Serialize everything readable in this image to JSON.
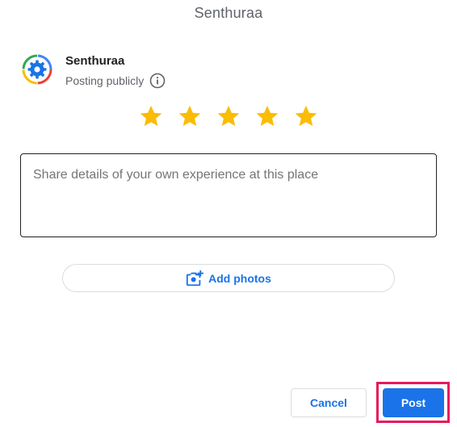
{
  "dialog": {
    "title": "Senthuraa"
  },
  "author": {
    "name": "Senthuraa",
    "visibility": "Posting publicly"
  },
  "rating": {
    "value": 5,
    "max": 5,
    "star_color": "#fbbc04"
  },
  "review": {
    "placeholder": "Share details of your own experience at this place",
    "value": ""
  },
  "add_photos": {
    "label": "Add photos"
  },
  "actions": {
    "cancel_label": "Cancel",
    "post_label": "Post"
  },
  "colors": {
    "accent": "#1a73e8",
    "highlight": "#e8185c"
  }
}
